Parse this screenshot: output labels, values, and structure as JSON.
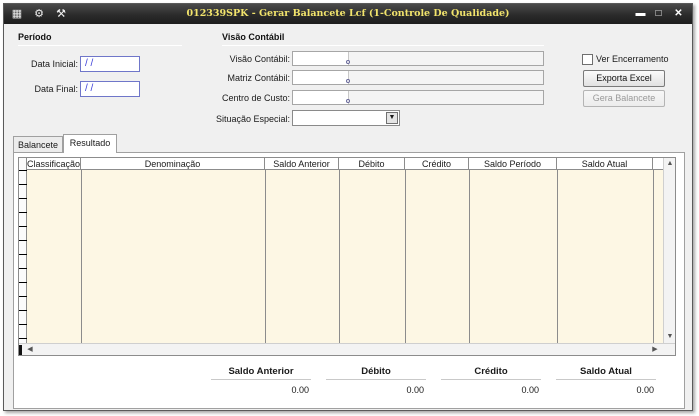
{
  "window": {
    "title": "012339SPK - Gerar Balancete Lcf (1-Controle De Qualidade)",
    "icons": [
      "form-icon",
      "gear-icon",
      "wrench-icon"
    ],
    "controls": [
      "minimize-icon",
      "maximize-icon",
      "close-icon"
    ]
  },
  "periodo": {
    "title": "Período",
    "data_inicial_label": "Data Inicial:",
    "data_inicial_value": " / /",
    "data_final_label": "Data Final:",
    "data_final_value": " / /"
  },
  "visao": {
    "title": "Visão Contábil",
    "visao_label": "Visão Contábil:",
    "matriz_label": "Matriz Contábil:",
    "centro_label": "Centro de Custo:",
    "situacao_label": "Situação Especial:",
    "situacao_value": ""
  },
  "options": {
    "ver_encerramento_label": "Ver Encerramento",
    "ver_encerramento_checked": false,
    "exporta_label": "Exporta Excel",
    "gera_label": "Gera Balancete"
  },
  "tabs": [
    {
      "label": "Balancete",
      "active": false
    },
    {
      "label": "Resultado",
      "active": true
    }
  ],
  "grid": {
    "columns": [
      "Classificação",
      "Denominação",
      "Saldo Anterior",
      "Débito",
      "Crédito",
      "Saldo Período",
      "Saldo Atual"
    ]
  },
  "totals": [
    {
      "label": "Saldo Anterior",
      "value": "0.00"
    },
    {
      "label": "Débito",
      "value": "0.00"
    },
    {
      "label": "Crédito",
      "value": "0.00"
    },
    {
      "label": "Saldo Atual",
      "value": "0.00"
    }
  ],
  "colors": {
    "title_text": "#f2e46c",
    "grid_background": "#fdf7e4",
    "date_input_border": "#6f76c9"
  }
}
